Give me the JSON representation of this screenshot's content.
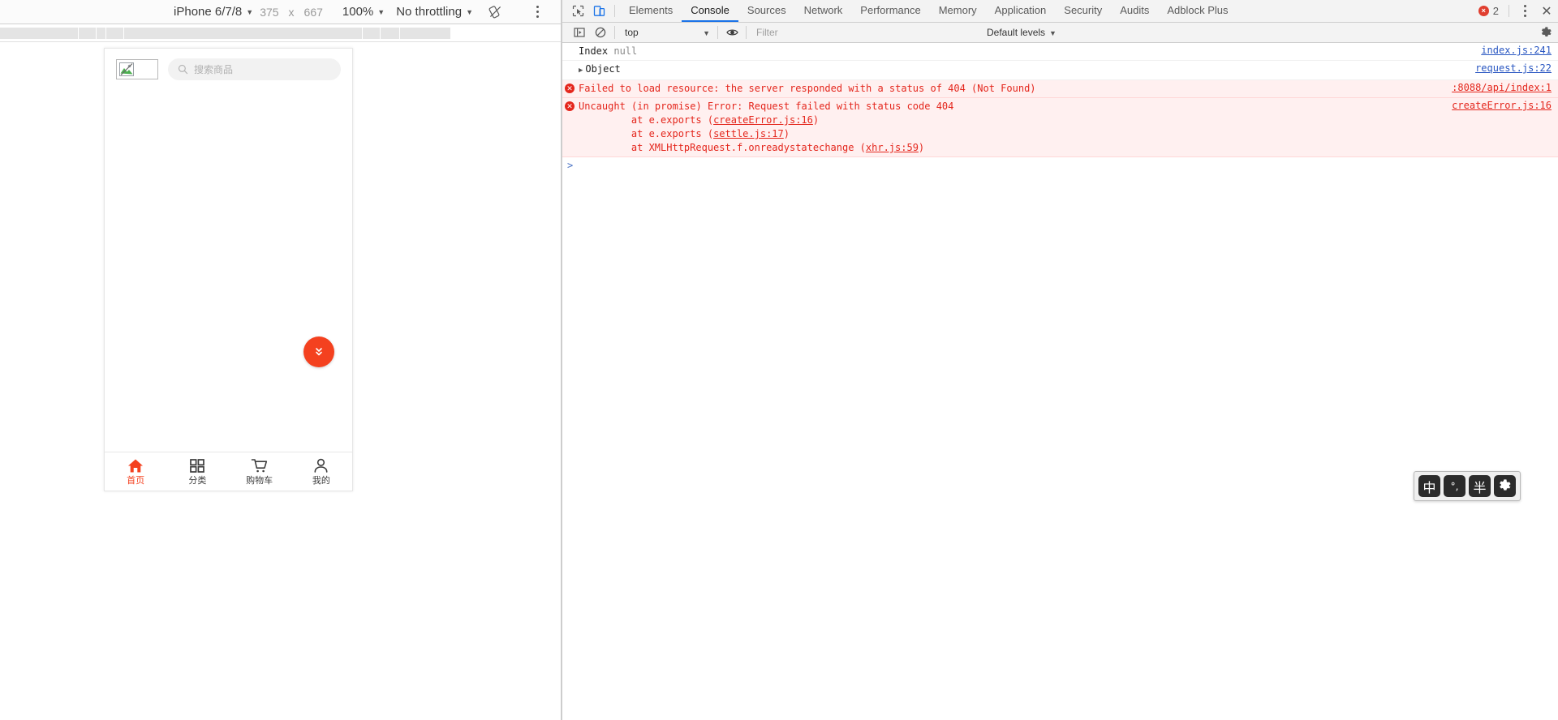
{
  "emulation": {
    "device": "iPhone 6/7/8",
    "width": "375",
    "times": "x",
    "height": "667",
    "zoom": "100%",
    "throttling": "No throttling",
    "rotate_icon": "rotate-icon",
    "menu_icon": "kebab-menu-icon"
  },
  "page": {
    "logo_alt": "broken-image",
    "search_placeholder": "搜索商品",
    "search_icon": "search-icon",
    "fab_icon": "double-chevron-down-icon",
    "tabs": [
      {
        "label": "首页",
        "icon": "home-icon",
        "active": true
      },
      {
        "label": "分类",
        "icon": "grid-icon",
        "active": false
      },
      {
        "label": "购物车",
        "icon": "cart-icon",
        "active": false
      },
      {
        "label": "我的",
        "icon": "person-icon",
        "active": false
      }
    ]
  },
  "devtools": {
    "inspect_icon": "inspect-element-icon",
    "device_toggle_icon": "toggle-device-toolbar-icon",
    "tabs": [
      {
        "label": "Elements",
        "selected": false
      },
      {
        "label": "Console",
        "selected": true
      },
      {
        "label": "Sources",
        "selected": false
      },
      {
        "label": "Network",
        "selected": false
      },
      {
        "label": "Performance",
        "selected": false
      },
      {
        "label": "Memory",
        "selected": false
      },
      {
        "label": "Application",
        "selected": false
      },
      {
        "label": "Security",
        "selected": false
      },
      {
        "label": "Audits",
        "selected": false
      },
      {
        "label": "Adblock Plus",
        "selected": false
      }
    ],
    "error_count": "2",
    "error_badge_glyph": "×",
    "more_icon": "kebab-menu-icon",
    "close_icon": "close-icon",
    "filterbar": {
      "sidebar_icon": "console-sidebar-icon",
      "clear_icon": "clear-console-icon",
      "context": "top",
      "eye_icon": "live-expression-icon",
      "filter_placeholder": "Filter",
      "filter_value": "",
      "levels": "Default levels",
      "settings_icon": "gear-icon"
    },
    "console": {
      "messages": [
        {
          "type": "log",
          "text": "Index ",
          "value": "null",
          "source": "index.js:241"
        },
        {
          "type": "object",
          "text": "Object",
          "source": "request.js:22"
        },
        {
          "type": "error",
          "text": "Failed to load resource: the server responded with a status of 404 (Not Found)",
          "source": ":8088/api/index:1"
        },
        {
          "type": "error",
          "text": "Uncaught (in promise) Error: Request failed with status code 404",
          "source": "createError.js:16",
          "stack": [
            {
              "prefix": "    at e.exports (",
              "link": "createError.js:16",
              "suffix": ")"
            },
            {
              "prefix": "    at e.exports (",
              "link": "settle.js:17",
              "suffix": ")"
            },
            {
              "prefix": "    at XMLHttpRequest.f.onreadystatechange (",
              "link": "xhr.js:59",
              "suffix": ")"
            }
          ]
        }
      ],
      "prompt_symbol": ">"
    }
  },
  "ime": {
    "keys": [
      {
        "label": "中",
        "name": "ime-language-toggle"
      },
      {
        "label": "°,",
        "name": "ime-punctuation-toggle"
      },
      {
        "label": "半",
        "name": "ime-width-toggle"
      },
      {
        "label": "gear",
        "name": "ime-settings"
      }
    ]
  },
  "colors": {
    "accent_red": "#f4411f",
    "error_red": "#e4261c",
    "tab_blue": "#1a73e8"
  }
}
